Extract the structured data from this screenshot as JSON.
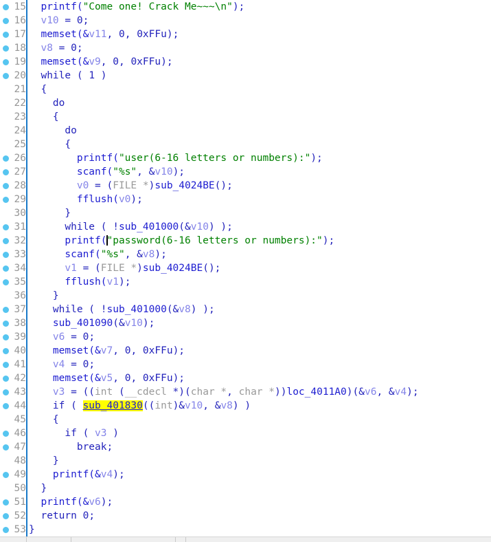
{
  "app": {
    "view_name": "Pseudocode",
    "first_visible_line": 15,
    "last_visible_line": 53
  },
  "editor": {
    "caret": {
      "line": 32,
      "after_text": "printf("
    },
    "highlight": {
      "line": 44,
      "token": "sub_401830",
      "color": "#ffff00"
    },
    "gutter_dot_color": "#56c5f0",
    "gutter_rule_color": "#1878c8",
    "background": "#ffffff"
  },
  "code_lines": [
    {
      "n": 15,
      "dot": true,
      "indent": 2,
      "tokens": [
        {
          "t": "printf(",
          "c": "fn"
        },
        {
          "t": "\"Come one! Crack Me~~~\\n\"",
          "c": "str"
        },
        {
          "t": ");",
          "c": "plain"
        }
      ]
    },
    {
      "n": 16,
      "dot": true,
      "indent": 2,
      "tokens": [
        {
          "t": "v10",
          "c": "var"
        },
        {
          "t": " = ",
          "c": "plain"
        },
        {
          "t": "0",
          "c": "num"
        },
        {
          "t": ";",
          "c": "plain"
        }
      ]
    },
    {
      "n": 17,
      "dot": true,
      "indent": 2,
      "tokens": [
        {
          "t": "memset(&",
          "c": "fn"
        },
        {
          "t": "v11",
          "c": "var"
        },
        {
          "t": ", ",
          "c": "plain"
        },
        {
          "t": "0",
          "c": "num"
        },
        {
          "t": ", ",
          "c": "plain"
        },
        {
          "t": "0xFFu",
          "c": "num"
        },
        {
          "t": ");",
          "c": "plain"
        }
      ]
    },
    {
      "n": 18,
      "dot": true,
      "indent": 2,
      "tokens": [
        {
          "t": "v8",
          "c": "var"
        },
        {
          "t": " = ",
          "c": "plain"
        },
        {
          "t": "0",
          "c": "num"
        },
        {
          "t": ";",
          "c": "plain"
        }
      ]
    },
    {
      "n": 19,
      "dot": true,
      "indent": 2,
      "tokens": [
        {
          "t": "memset(&",
          "c": "fn"
        },
        {
          "t": "v9",
          "c": "var"
        },
        {
          "t": ", ",
          "c": "plain"
        },
        {
          "t": "0",
          "c": "num"
        },
        {
          "t": ", ",
          "c": "plain"
        },
        {
          "t": "0xFFu",
          "c": "num"
        },
        {
          "t": ");",
          "c": "plain"
        }
      ]
    },
    {
      "n": 20,
      "dot": true,
      "indent": 2,
      "tokens": [
        {
          "t": "while ( ",
          "c": "kw"
        },
        {
          "t": "1",
          "c": "num"
        },
        {
          "t": " )",
          "c": "plain"
        }
      ]
    },
    {
      "n": 21,
      "dot": false,
      "indent": 2,
      "tokens": [
        {
          "t": "{",
          "c": "plain"
        }
      ]
    },
    {
      "n": 22,
      "dot": false,
      "indent": 4,
      "tokens": [
        {
          "t": "do",
          "c": "kw"
        }
      ]
    },
    {
      "n": 23,
      "dot": false,
      "indent": 4,
      "tokens": [
        {
          "t": "{",
          "c": "plain"
        }
      ]
    },
    {
      "n": 24,
      "dot": false,
      "indent": 6,
      "tokens": [
        {
          "t": "do",
          "c": "kw"
        }
      ]
    },
    {
      "n": 25,
      "dot": false,
      "indent": 6,
      "tokens": [
        {
          "t": "{",
          "c": "plain"
        }
      ]
    },
    {
      "n": 26,
      "dot": true,
      "indent": 8,
      "tokens": [
        {
          "t": "printf(",
          "c": "fn"
        },
        {
          "t": "\"user(6-16 letters or numbers):\"",
          "c": "str"
        },
        {
          "t": ");",
          "c": "plain"
        }
      ]
    },
    {
      "n": 27,
      "dot": true,
      "indent": 8,
      "tokens": [
        {
          "t": "scanf(",
          "c": "fn"
        },
        {
          "t": "\"%s\"",
          "c": "str"
        },
        {
          "t": ", &",
          "c": "plain"
        },
        {
          "t": "v10",
          "c": "var"
        },
        {
          "t": ");",
          "c": "plain"
        }
      ]
    },
    {
      "n": 28,
      "dot": true,
      "indent": 8,
      "tokens": [
        {
          "t": "v0",
          "c": "var"
        },
        {
          "t": " = (",
          "c": "plain"
        },
        {
          "t": "FILE *",
          "c": "type"
        },
        {
          "t": ")",
          "c": "plain"
        },
        {
          "t": "sub_4024BE",
          "c": "fn"
        },
        {
          "t": "();",
          "c": "plain"
        }
      ]
    },
    {
      "n": 29,
      "dot": true,
      "indent": 8,
      "tokens": [
        {
          "t": "fflush(",
          "c": "fn"
        },
        {
          "t": "v0",
          "c": "var"
        },
        {
          "t": ");",
          "c": "plain"
        }
      ]
    },
    {
      "n": 30,
      "dot": false,
      "indent": 6,
      "tokens": [
        {
          "t": "}",
          "c": "plain"
        }
      ]
    },
    {
      "n": 31,
      "dot": true,
      "indent": 6,
      "tokens": [
        {
          "t": "while ( !",
          "c": "kw"
        },
        {
          "t": "sub_401000",
          "c": "fn"
        },
        {
          "t": "(&",
          "c": "plain"
        },
        {
          "t": "v10",
          "c": "var"
        },
        {
          "t": ") );",
          "c": "plain"
        }
      ]
    },
    {
      "n": 32,
      "dot": true,
      "indent": 6,
      "caret_after": 0,
      "tokens": [
        {
          "t": "printf(",
          "c": "fn"
        },
        {
          "t": "\"password(6-16 letters or numbers):\"",
          "c": "str"
        },
        {
          "t": ");",
          "c": "plain"
        }
      ]
    },
    {
      "n": 33,
      "dot": true,
      "indent": 6,
      "tokens": [
        {
          "t": "scanf(",
          "c": "fn"
        },
        {
          "t": "\"%s\"",
          "c": "str"
        },
        {
          "t": ", &",
          "c": "plain"
        },
        {
          "t": "v8",
          "c": "var"
        },
        {
          "t": ");",
          "c": "plain"
        }
      ]
    },
    {
      "n": 34,
      "dot": true,
      "indent": 6,
      "tokens": [
        {
          "t": "v1",
          "c": "var"
        },
        {
          "t": " = (",
          "c": "plain"
        },
        {
          "t": "FILE *",
          "c": "type"
        },
        {
          "t": ")",
          "c": "plain"
        },
        {
          "t": "sub_4024BE",
          "c": "fn"
        },
        {
          "t": "();",
          "c": "plain"
        }
      ]
    },
    {
      "n": 35,
      "dot": true,
      "indent": 6,
      "tokens": [
        {
          "t": "fflush(",
          "c": "fn"
        },
        {
          "t": "v1",
          "c": "var"
        },
        {
          "t": ");",
          "c": "plain"
        }
      ]
    },
    {
      "n": 36,
      "dot": false,
      "indent": 4,
      "tokens": [
        {
          "t": "}",
          "c": "plain"
        }
      ]
    },
    {
      "n": 37,
      "dot": true,
      "indent": 4,
      "tokens": [
        {
          "t": "while ( !",
          "c": "kw"
        },
        {
          "t": "sub_401000",
          "c": "fn"
        },
        {
          "t": "(&",
          "c": "plain"
        },
        {
          "t": "v8",
          "c": "var"
        },
        {
          "t": ") );",
          "c": "plain"
        }
      ]
    },
    {
      "n": 38,
      "dot": true,
      "indent": 4,
      "tokens": [
        {
          "t": "sub_401090",
          "c": "fn"
        },
        {
          "t": "(&",
          "c": "plain"
        },
        {
          "t": "v10",
          "c": "var"
        },
        {
          "t": ");",
          "c": "plain"
        }
      ]
    },
    {
      "n": 39,
      "dot": true,
      "indent": 4,
      "tokens": [
        {
          "t": "v6",
          "c": "var"
        },
        {
          "t": " = ",
          "c": "plain"
        },
        {
          "t": "0",
          "c": "num"
        },
        {
          "t": ";",
          "c": "plain"
        }
      ]
    },
    {
      "n": 40,
      "dot": true,
      "indent": 4,
      "tokens": [
        {
          "t": "memset(&",
          "c": "fn"
        },
        {
          "t": "v7",
          "c": "var"
        },
        {
          "t": ", ",
          "c": "plain"
        },
        {
          "t": "0",
          "c": "num"
        },
        {
          "t": ", ",
          "c": "plain"
        },
        {
          "t": "0xFFu",
          "c": "num"
        },
        {
          "t": ");",
          "c": "plain"
        }
      ]
    },
    {
      "n": 41,
      "dot": true,
      "indent": 4,
      "tokens": [
        {
          "t": "v4",
          "c": "var"
        },
        {
          "t": " = ",
          "c": "plain"
        },
        {
          "t": "0",
          "c": "num"
        },
        {
          "t": ";",
          "c": "plain"
        }
      ]
    },
    {
      "n": 42,
      "dot": true,
      "indent": 4,
      "tokens": [
        {
          "t": "memset(&",
          "c": "fn"
        },
        {
          "t": "v5",
          "c": "var"
        },
        {
          "t": ", ",
          "c": "plain"
        },
        {
          "t": "0",
          "c": "num"
        },
        {
          "t": ", ",
          "c": "plain"
        },
        {
          "t": "0xFFu",
          "c": "num"
        },
        {
          "t": ");",
          "c": "plain"
        }
      ]
    },
    {
      "n": 43,
      "dot": true,
      "indent": 4,
      "tokens": [
        {
          "t": "v3",
          "c": "var"
        },
        {
          "t": " = ((",
          "c": "plain"
        },
        {
          "t": "int",
          "c": "type"
        },
        {
          "t": " (",
          "c": "plain"
        },
        {
          "t": "__cdecl",
          "c": "type"
        },
        {
          "t": " *)(",
          "c": "plain"
        },
        {
          "t": "char *",
          "c": "type"
        },
        {
          "t": ", ",
          "c": "plain"
        },
        {
          "t": "char *",
          "c": "type"
        },
        {
          "t": "))",
          "c": "plain"
        },
        {
          "t": "loc_4011A0",
          "c": "fn"
        },
        {
          "t": ")(&",
          "c": "plain"
        },
        {
          "t": "v6",
          "c": "var"
        },
        {
          "t": ", &",
          "c": "plain"
        },
        {
          "t": "v4",
          "c": "var"
        },
        {
          "t": ");",
          "c": "plain"
        }
      ]
    },
    {
      "n": 44,
      "dot": true,
      "indent": 4,
      "tokens": [
        {
          "t": "if ( ",
          "c": "kw"
        },
        {
          "t": "sub_401830",
          "c": "hl"
        },
        {
          "t": "((",
          "c": "plain"
        },
        {
          "t": "int",
          "c": "type"
        },
        {
          "t": ")&",
          "c": "plain"
        },
        {
          "t": "v10",
          "c": "var"
        },
        {
          "t": ", &",
          "c": "plain"
        },
        {
          "t": "v8",
          "c": "var"
        },
        {
          "t": ") )",
          "c": "plain"
        }
      ]
    },
    {
      "n": 45,
      "dot": false,
      "indent": 4,
      "tokens": [
        {
          "t": "{",
          "c": "plain"
        }
      ]
    },
    {
      "n": 46,
      "dot": true,
      "indent": 6,
      "tokens": [
        {
          "t": "if ( ",
          "c": "kw"
        },
        {
          "t": "v3",
          "c": "var"
        },
        {
          "t": " )",
          "c": "plain"
        }
      ]
    },
    {
      "n": 47,
      "dot": true,
      "indent": 8,
      "tokens": [
        {
          "t": "break;",
          "c": "kw"
        }
      ]
    },
    {
      "n": 48,
      "dot": false,
      "indent": 4,
      "tokens": [
        {
          "t": "}",
          "c": "plain"
        }
      ]
    },
    {
      "n": 49,
      "dot": true,
      "indent": 4,
      "tokens": [
        {
          "t": "printf(&",
          "c": "fn"
        },
        {
          "t": "v4",
          "c": "var"
        },
        {
          "t": ");",
          "c": "plain"
        }
      ]
    },
    {
      "n": 50,
      "dot": false,
      "indent": 2,
      "tokens": [
        {
          "t": "}",
          "c": "plain"
        }
      ]
    },
    {
      "n": 51,
      "dot": true,
      "indent": 2,
      "tokens": [
        {
          "t": "printf(&",
          "c": "fn"
        },
        {
          "t": "v6",
          "c": "var"
        },
        {
          "t": ");",
          "c": "plain"
        }
      ]
    },
    {
      "n": 52,
      "dot": true,
      "indent": 2,
      "tokens": [
        {
          "t": "return ",
          "c": "kw"
        },
        {
          "t": "0",
          "c": "num"
        },
        {
          "t": ";",
          "c": "plain"
        }
      ]
    },
    {
      "n": 53,
      "dot": true,
      "indent": 0,
      "tokens": [
        {
          "t": "}",
          "c": "plain"
        }
      ]
    }
  ],
  "status_bar": {
    "divider_positions": [
      38,
      103,
      255,
      270
    ]
  }
}
